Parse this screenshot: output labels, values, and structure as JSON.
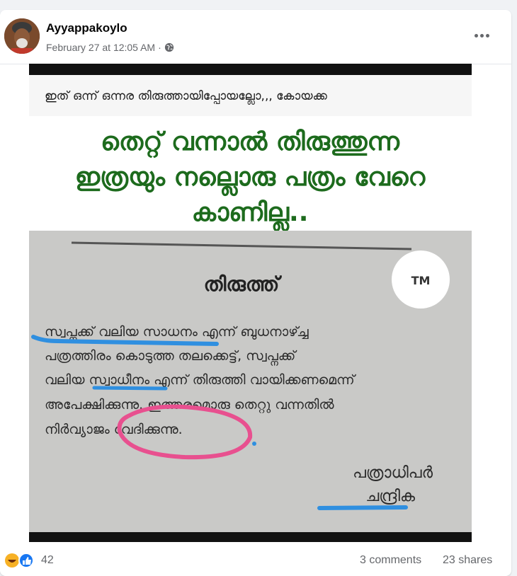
{
  "post": {
    "author": "Ayyappakoylo",
    "timestamp": "February 27 at 12:05 AM",
    "separator": "·",
    "privacy_icon": "globe-icon",
    "more_icon": "more-options-icon"
  },
  "image": {
    "top_line": "ഇത് ഒന്ന് ഒന്നര തിരുത്തായിപ്പോയല്ലോ,,, കോയക്ക",
    "headline_1": "തെറ്റ് വന്നാൽ തിരുത്തുന്ന",
    "headline_2": "ഇത്രയും നല്ലൊരു പത്രം വേറെ",
    "headline_3": "കാണില്ല..",
    "tm_badge": "TM",
    "clip_title": "തിരുത്ത്",
    "clip_line_1": "സ്വപ്നക്ക് വലിയ സാധനം എന്ന് ബുധനാഴ്ച്ച",
    "clip_line_2": "പത്രത്തിരം കൊടുത്ത തലക്കെട്ട്, സ്വപ്നക്ക്",
    "clip_line_3": "വലിയ സ്വാധീനം എന്ന് തിരുത്തി വായിക്കണമെന്ന്",
    "clip_line_4": "അപേക്ഷിക്കുന്നു. ഇത്തരമൊരു തെറ്റു വന്നതിൽ",
    "clip_line_5": "നിർവ്യാജം വേദിക്കുന്നു.",
    "sign_1": "പത്രാധിപർ",
    "sign_2": "ചന്ദ്രിക",
    "colors": {
      "headline_green": "#1d6b1d",
      "blue_marker": "#2f8fe0",
      "pink_marker": "#e8508f"
    }
  },
  "footer": {
    "reaction_icons": [
      "haha-icon",
      "like-icon"
    ],
    "reaction_count": "42",
    "comments": "3 comments",
    "shares": "23 shares"
  }
}
